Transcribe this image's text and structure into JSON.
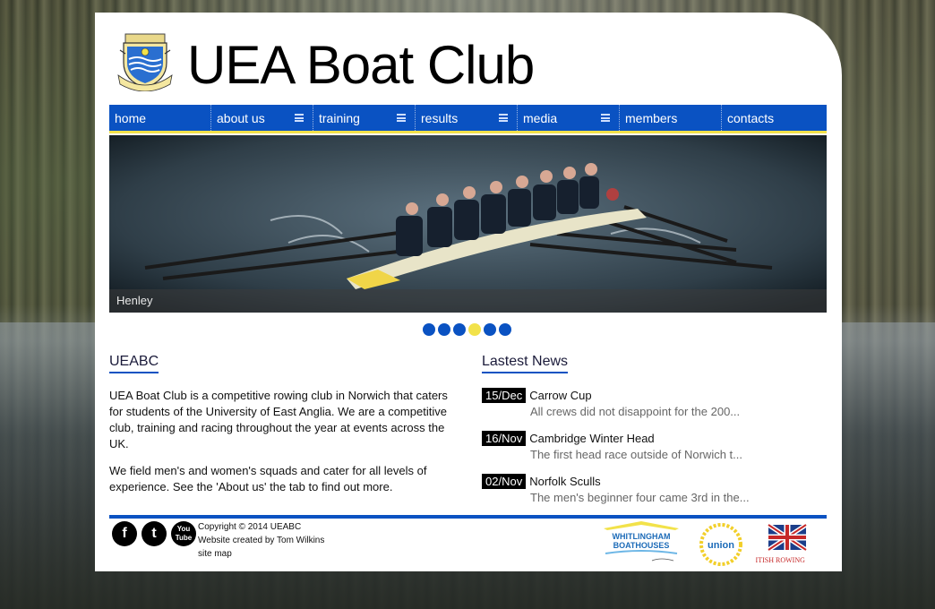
{
  "site": {
    "title": "UEA Boat Club"
  },
  "nav": {
    "items": [
      {
        "label": "home",
        "has_menu": false
      },
      {
        "label": "about us",
        "has_menu": true
      },
      {
        "label": "training",
        "has_menu": true
      },
      {
        "label": "results",
        "has_menu": true
      },
      {
        "label": "media",
        "has_menu": true
      },
      {
        "label": "members",
        "has_menu": false
      },
      {
        "label": "contacts",
        "has_menu": false
      }
    ]
  },
  "slider": {
    "caption": "Henley",
    "dots_count": 6,
    "active_dot": 4
  },
  "about": {
    "heading": "UEABC",
    "paragraphs": [
      "UEA Boat Club is a competitive rowing club in Norwich that caters for students of the University of East Anglia. We are a competitive club, training and racing throughout the year at events across the UK.",
      "We field men's and women's squads and cater for all levels of experience. See the 'About us' the tab to find out more."
    ]
  },
  "news": {
    "heading": "Lastest News",
    "items": [
      {
        "date": "15/Dec",
        "title": "Carrow Cup",
        "excerpt": "All crews did not disappoint for the 200..."
      },
      {
        "date": "16/Nov",
        "title": "Cambridge Winter Head",
        "excerpt": "The first head race outside of Norwich t..."
      },
      {
        "date": "02/Nov",
        "title": "Norfolk Sculls",
        "excerpt": "The men's beginner four came 3rd in the..."
      }
    ]
  },
  "footer": {
    "social": [
      {
        "name": "facebook",
        "glyph": "f"
      },
      {
        "name": "twitter",
        "glyph": "t"
      },
      {
        "name": "youtube",
        "glyph": "You Tube"
      }
    ],
    "copyright": "Copyright © 2014 UEABC",
    "credit": "Website created by Tom Wilkins",
    "sitemap": "site map",
    "sponsors": {
      "whitlingham_line1": "WHITLINGHAM",
      "whitlingham_line2": "BOATHOUSES",
      "union": "union",
      "british_rowing_1": "BRITISH",
      "british_rowing_2": "ROWING"
    }
  },
  "colors": {
    "nav_blue": "#0a52c2",
    "accent_yellow": "#f2e24a"
  }
}
